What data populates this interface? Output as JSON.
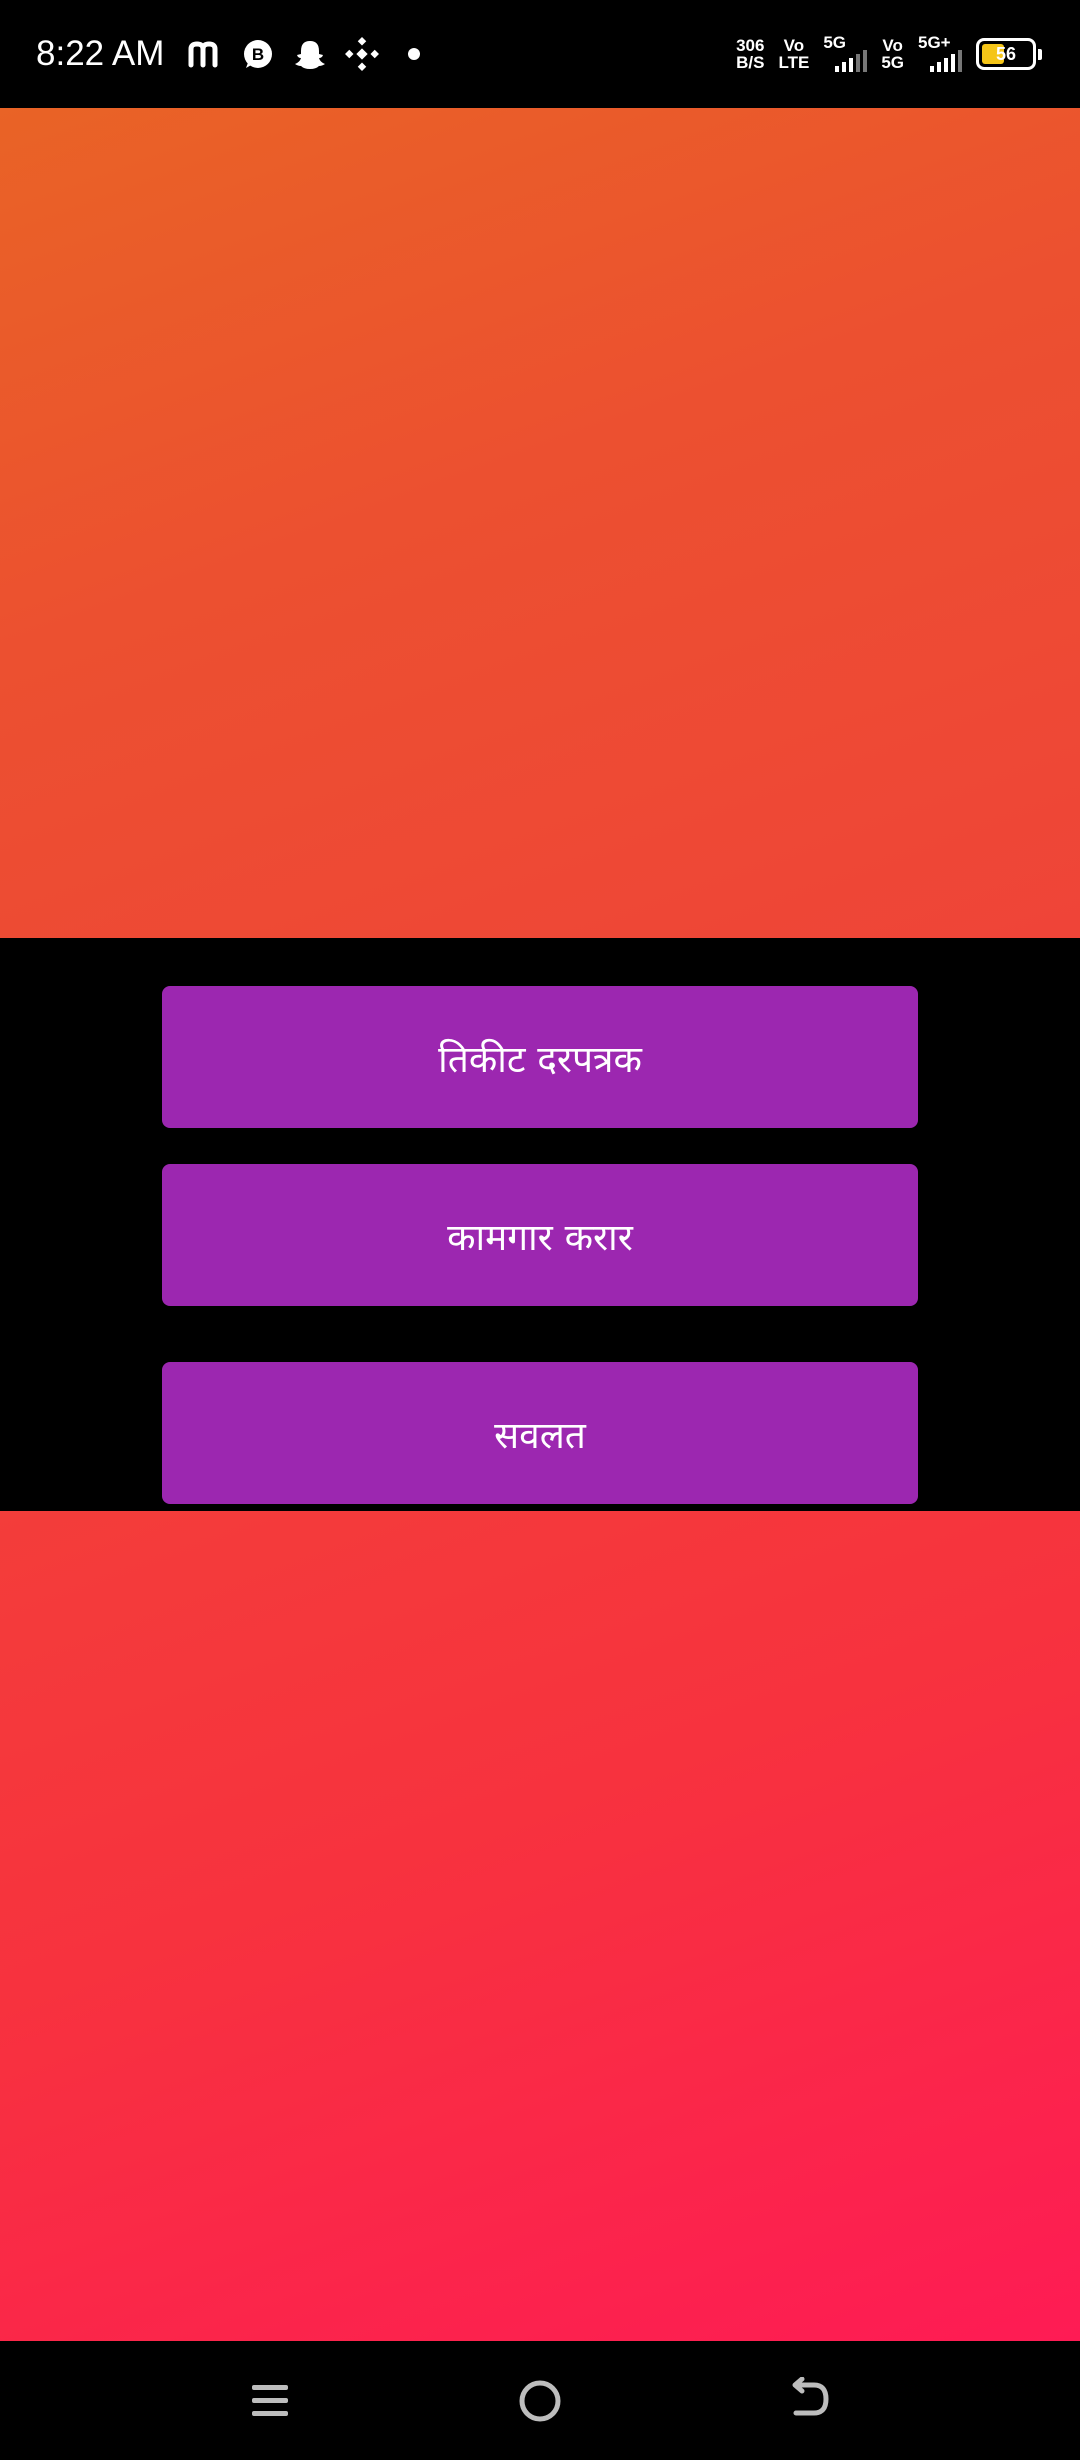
{
  "status_bar": {
    "time": "8:22 AM",
    "notification_icons": [
      "m-app-icon",
      "whatsapp-business-icon",
      "snapchat-icon",
      "binance-icon",
      "dot-icon"
    ],
    "net_speed_value": "306",
    "net_speed_unit": "B/S",
    "sim1_volte_top": "Vo",
    "sim1_volte_bottom": "LTE",
    "sim1_network": "5G",
    "sim2_volte_top": "Vo",
    "sim2_volte_bottom": "5G",
    "sim2_network": "5G+",
    "battery_level": "56",
    "battery_color": "#f5c518"
  },
  "colors": {
    "button_bg": "#9c27b0",
    "top_gradient": [
      "#e96326",
      "#ef4438"
    ],
    "bottom_gradient": [
      "#f33d3a",
      "#fe1b54"
    ]
  },
  "menu": {
    "buttons": [
      {
        "label": "तिकीट दरपत्रक"
      },
      {
        "label": "कामगार करार"
      },
      {
        "label": "सवलत"
      }
    ]
  },
  "nav_bar": {
    "icons": [
      "menu-icon",
      "home-icon",
      "back-icon"
    ]
  }
}
